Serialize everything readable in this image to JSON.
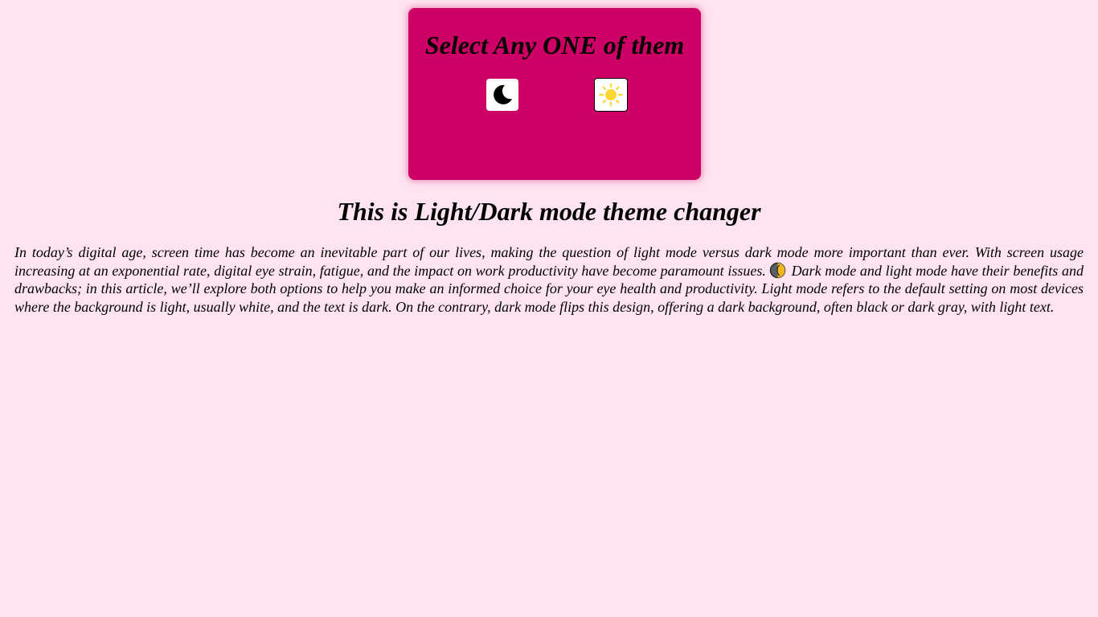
{
  "card": {
    "title": "Select Any ONE of them",
    "background_color": "#cd0066",
    "dark_button": {
      "icon": "moon-icon"
    },
    "light_button": {
      "icon": "sun-icon"
    }
  },
  "page": {
    "background_color": "#fee4f0",
    "heading": "This is Light/Dark mode theme changer",
    "paragraph_part1": "In today’s digital age, screen time has become an inevitable part of our lives, making the question of light mode versus dark mode more important than ever. With screen usage increasing at an exponential rate, digital eye strain, fatigue, and the impact on work productivity have become paramount issues.",
    "paragraph_icon": "half-moon-contrast-icon",
    "paragraph_part2": "Dark mode and light mode have their benefits and drawbacks; in this article, we’ll explore both options to help you make an informed choice for your eye health and productivity. Light mode refers to the default setting on most devices where the background is light, usually white, and the text is dark. On the contrary, dark mode flips this design, offering a dark background, often black or dark gray, with light text."
  }
}
